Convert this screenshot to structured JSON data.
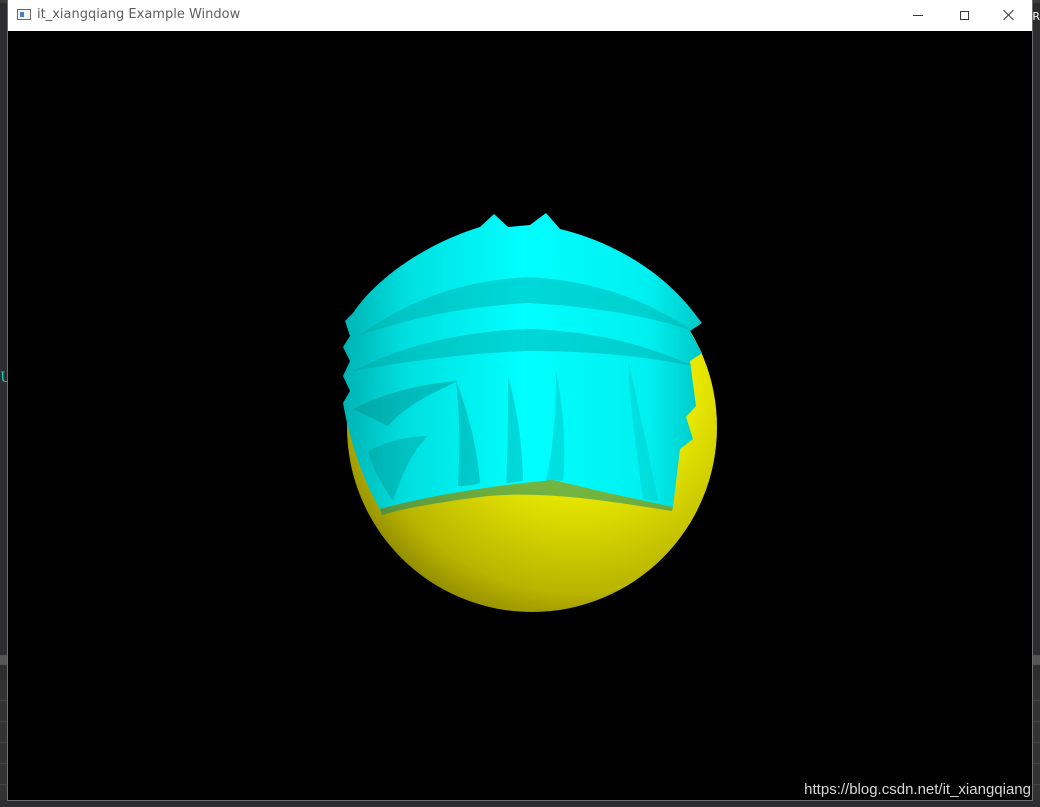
{
  "window": {
    "title": "it_xiangqiang Example Window",
    "icon": "app-window-icon",
    "controls": {
      "minimize_icon": "minimize-icon",
      "maximize_icon": "maximize-icon",
      "close_icon": "close-icon"
    }
  },
  "scene": {
    "background_color": "#000000",
    "sphere_color": "#e6e600",
    "cloth_color": "#00ffff"
  },
  "watermark": {
    "text": "https://blog.csdn.net/it_xiangqiang"
  },
  "background": {
    "left_glyph": "U",
    "right_glyph": "R"
  }
}
